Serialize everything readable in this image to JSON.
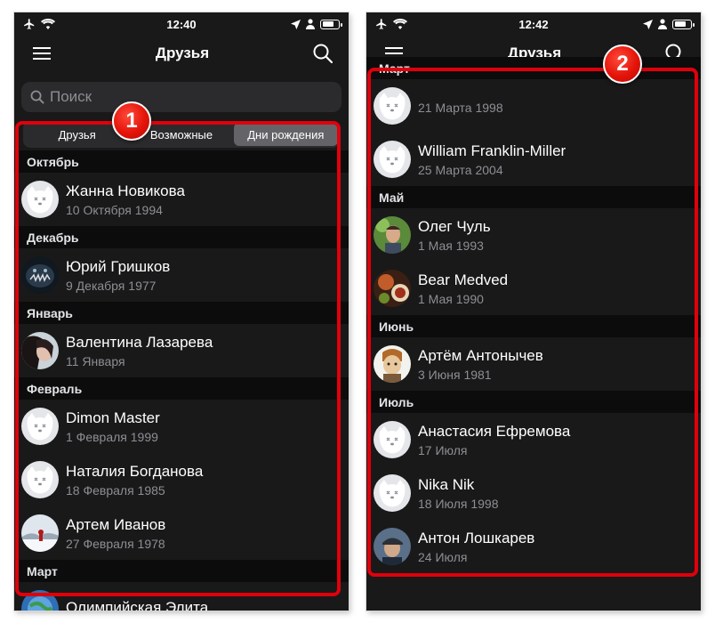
{
  "screen1": {
    "status": {
      "time": "12:40"
    },
    "nav": {
      "title": "Друзья"
    },
    "search": {
      "placeholder": "Поиск"
    },
    "tabs": [
      {
        "label": "Друзья",
        "active": false
      },
      {
        "label": "Возможные",
        "active": false
      },
      {
        "label": "Дни рождения",
        "active": true
      }
    ],
    "badge": "1",
    "groups": [
      {
        "month": "Октябрь",
        "friends": [
          {
            "name": "Жанна Новикова",
            "date": "10 Октября 1994",
            "avatar": "default-avatar"
          }
        ]
      },
      {
        "month": "Декабрь",
        "friends": [
          {
            "name": "Юрий Гришков",
            "date": "9 Декабря 1977",
            "avatar": "photo-fish"
          }
        ]
      },
      {
        "month": "Январь",
        "friends": [
          {
            "name": "Валентина Лазарева",
            "date": "11 Января",
            "avatar": "photo-girl"
          }
        ]
      },
      {
        "month": "Февраль",
        "friends": [
          {
            "name": "Dimon Master",
            "date": "1 Февраля 1999",
            "avatar": "default-avatar"
          },
          {
            "name": "Наталия Богданова",
            "date": "18 Февраля 1985",
            "avatar": "default-avatar"
          },
          {
            "name": "Артем Иванов",
            "date": "27 Февраля 1978",
            "avatar": "photo-snow"
          }
        ]
      },
      {
        "month": "Март",
        "friends": [
          {
            "name": "Олимпийская Элита",
            "date": "",
            "avatar": "photo-globe"
          }
        ]
      }
    ]
  },
  "screen2": {
    "status": {
      "time": "12:42"
    },
    "nav": {
      "title": "Друзья"
    },
    "badge": "2",
    "groups": [
      {
        "month": "Март",
        "friends": [
          {
            "name": "",
            "date": "21 Марта 1998",
            "avatar": "default-avatar"
          },
          {
            "name": "William Franklin-Miller",
            "date": "25 Марта 2004",
            "avatar": "default-avatar"
          }
        ]
      },
      {
        "month": "Май",
        "friends": [
          {
            "name": "Олег Чуль",
            "date": "1 Мая 1993",
            "avatar": "photo-man-green"
          },
          {
            "name": "Bear Medved",
            "date": "1 Мая 1990",
            "avatar": "photo-food"
          }
        ]
      },
      {
        "month": "Июнь",
        "friends": [
          {
            "name": "Артём Антонычев",
            "date": "3 Июня 1981",
            "avatar": "photo-cartoon"
          }
        ]
      },
      {
        "month": "Июль",
        "friends": [
          {
            "name": "Анастасия Ефремова",
            "date": "17 Июля",
            "avatar": "default-avatar"
          },
          {
            "name": "Nika Nik",
            "date": "18 Июля 1998",
            "avatar": "default-avatar"
          },
          {
            "name": "Антон Лошкарев",
            "date": "24 Июля",
            "avatar": "photo-man-cap"
          }
        ]
      }
    ]
  },
  "colors": {
    "background": "#19191a",
    "section": "#0c0c0d",
    "accent_red": "#e0000b",
    "secondary_text": "#8d8e93"
  }
}
